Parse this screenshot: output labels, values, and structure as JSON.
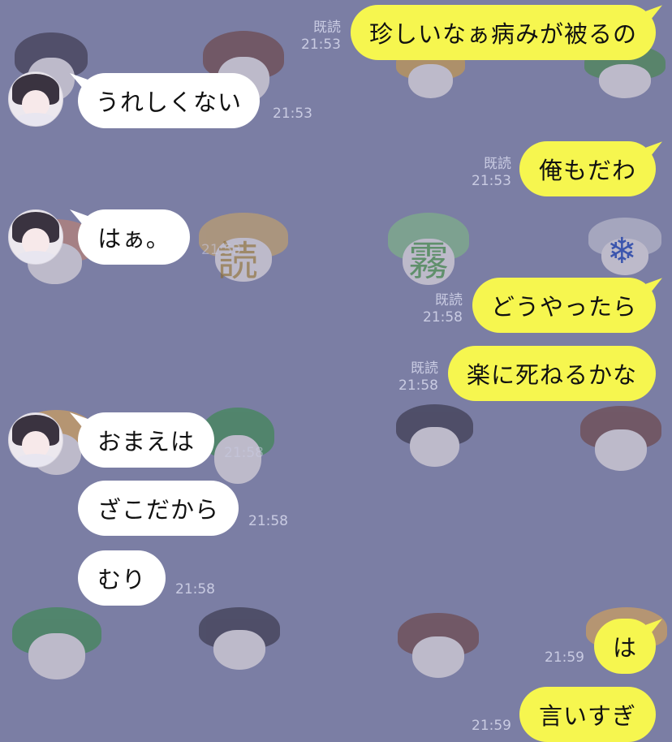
{
  "colors": {
    "background": "#7b7ea4",
    "mine_bubble": "#f6f64f",
    "their_bubble": "#ffffff",
    "meta_text": "#c9cbe2"
  },
  "messages": [
    {
      "side": "mine",
      "text": "珍しいなぁ病みが被るの",
      "read": "既読",
      "time": "21:53"
    },
    {
      "side": "theirs",
      "text": "うれしくない",
      "time": "21:53"
    },
    {
      "side": "mine",
      "text": "俺もだわ",
      "read": "既読",
      "time": "21:53"
    },
    {
      "side": "theirs",
      "text": "はぁ。",
      "time": "21:53"
    },
    {
      "side": "mine",
      "text": "どうやったら",
      "read": "既読",
      "time": "21:58"
    },
    {
      "side": "mine",
      "text": "楽に死ねるかな",
      "read": "既読",
      "time": "21:58"
    },
    {
      "side": "theirs",
      "text": "おまえは",
      "time": "21:58"
    },
    {
      "side": "theirs",
      "text": "ざこだから",
      "time": "21:58"
    },
    {
      "side": "theirs",
      "text": "むり",
      "time": "21:58"
    },
    {
      "side": "mine",
      "text": "は",
      "time": "21:59"
    },
    {
      "side": "mine",
      "text": "言いすぎ",
      "time": "21:59"
    }
  ],
  "wallpaper": {
    "kanji": [
      "読",
      "霧"
    ],
    "snow_symbol": "❄"
  }
}
